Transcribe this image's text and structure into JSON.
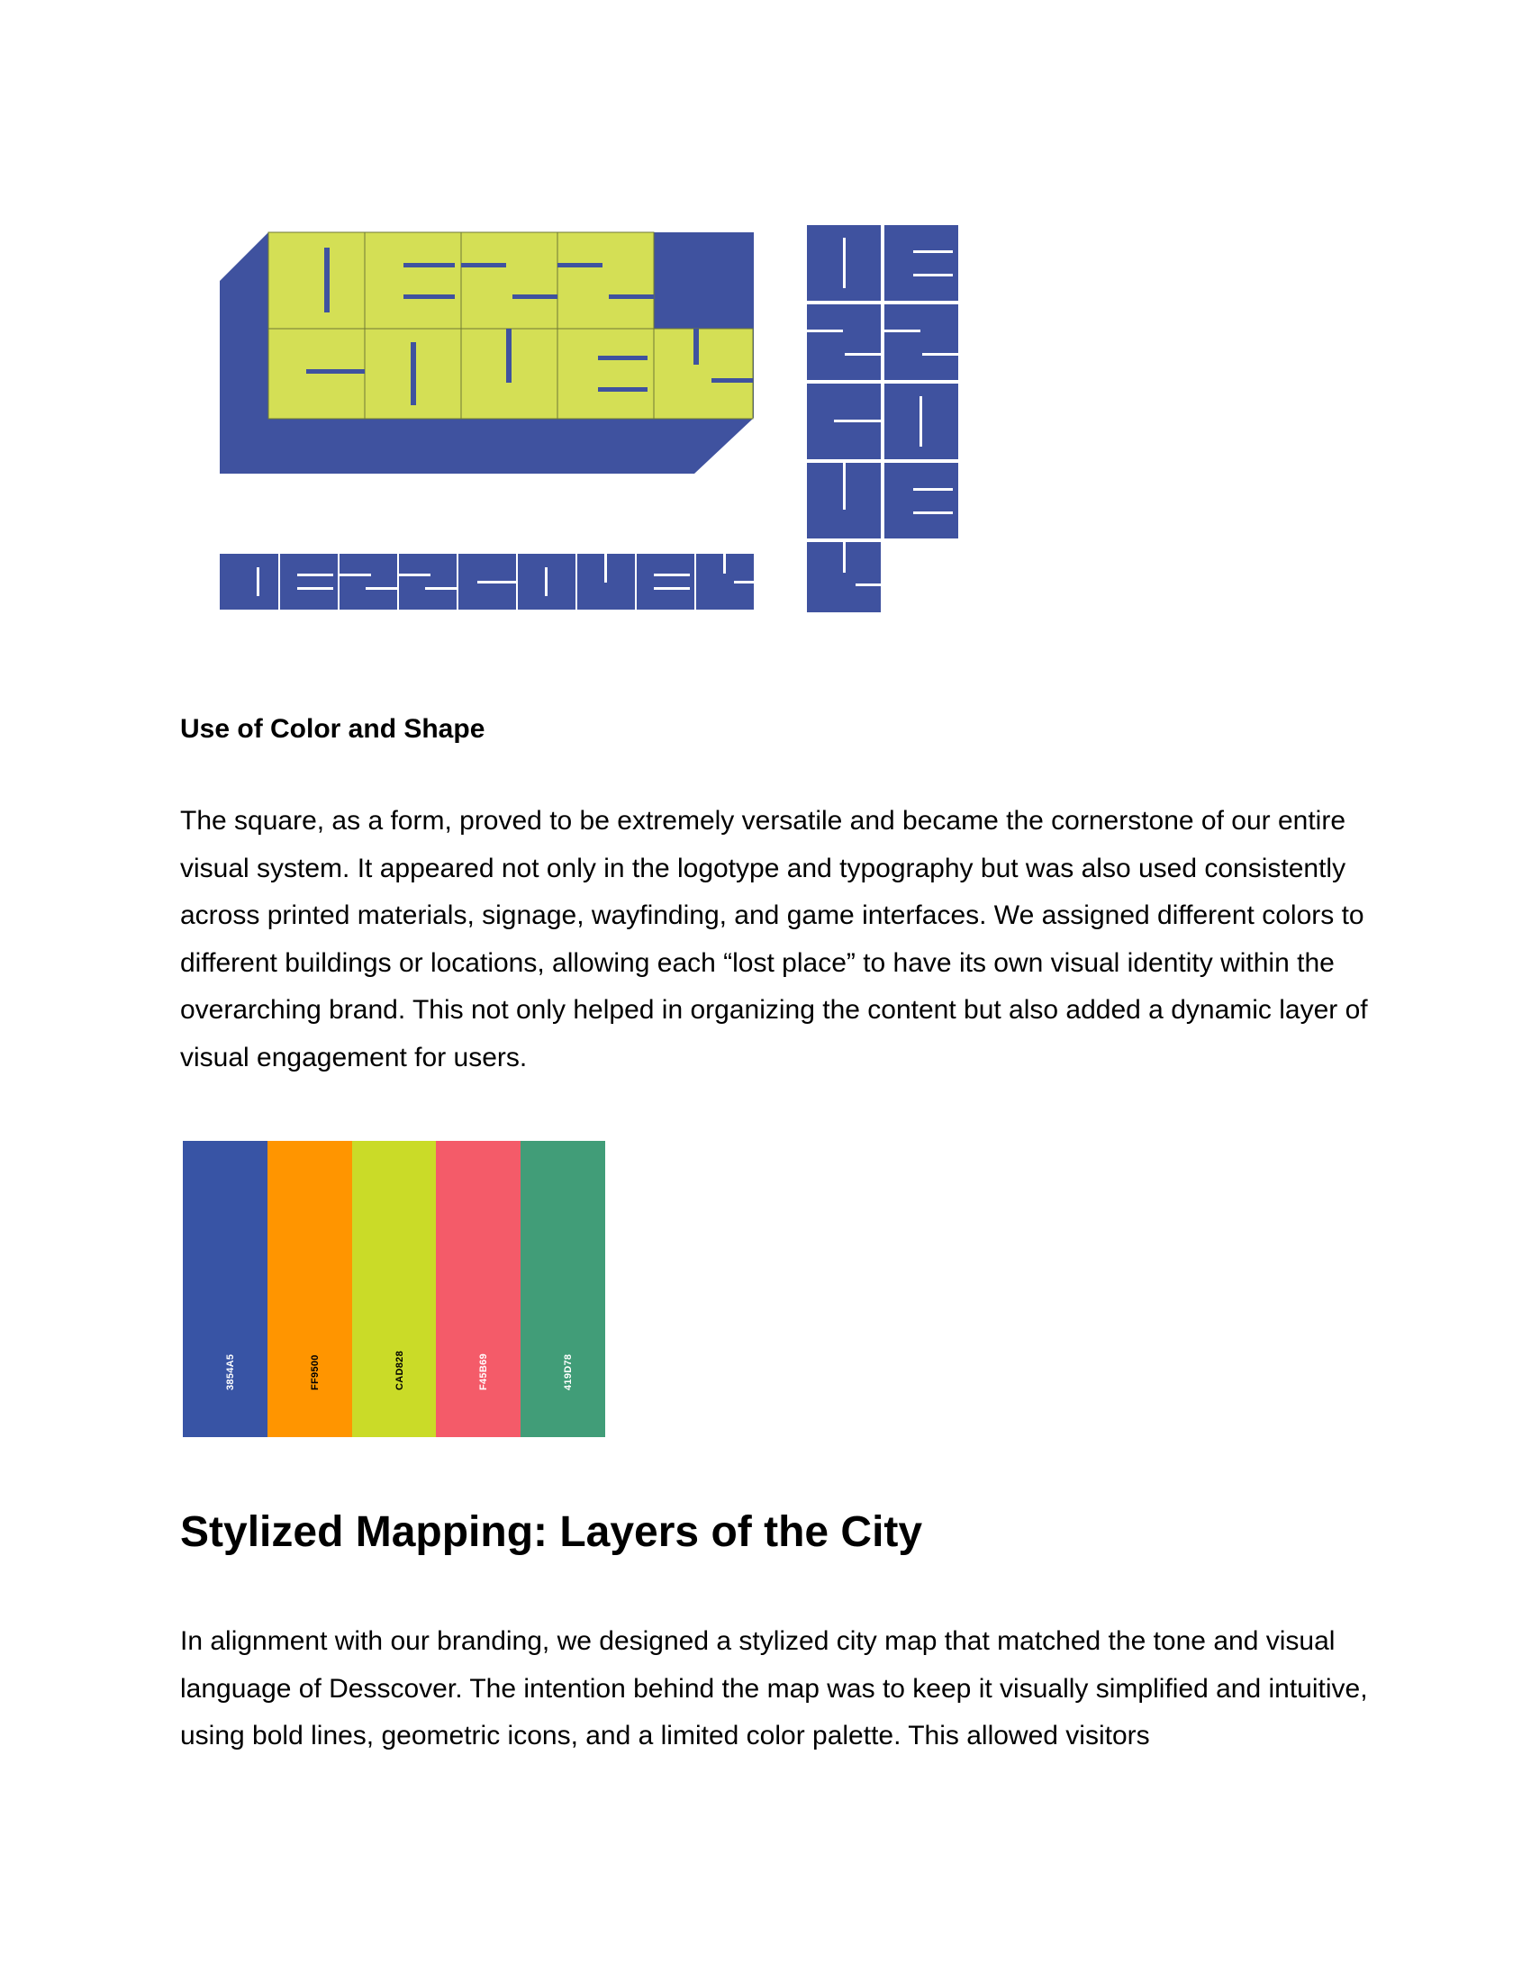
{
  "colors": {
    "brand_blue": "#3F529F",
    "brand_lime": "#D4DF55"
  },
  "logo_variants": [
    "horizontal-3d-wordmark",
    "single-line-wordmark",
    "vertical-stacked-wordmark"
  ],
  "section_heading": "Use of Color and Shape",
  "paragraph_1": "The square, as a form, proved to be extremely versatile and became the cornerstone of our entire visual system. It appeared not only in the logotype and typography but was also used consistently across printed materials, signage, wayfinding, and game interfaces. We assigned different colors to different buildings or locations, allowing each “lost place” to have its own visual identity within the overarching brand. This not only helped in organizing the content but also added a dynamic layer of visual engagement for users.",
  "palette": [
    {
      "hex": "#3854A5",
      "label": "3854A5",
      "text_color": "#ffffff"
    },
    {
      "hex": "#FF9500",
      "label": "FF9500",
      "text_color": "#000000"
    },
    {
      "hex": "#CADB28",
      "label": "CAD828",
      "text_color": "#000000"
    },
    {
      "hex": "#F45B69",
      "label": "F45B69",
      "text_color": "#ffffff"
    },
    {
      "hex": "#419D78",
      "label": "419D78",
      "text_color": "#ffffff"
    }
  ],
  "main_heading": "Stylized Mapping: Layers of the City",
  "paragraph_2": "In alignment with our branding, we designed a stylized city map that matched the tone and visual language of Desscover. The intention behind the map was to keep it visually simplified and intuitive, using bold lines, geometric icons, and a limited color palette. This allowed visitors"
}
